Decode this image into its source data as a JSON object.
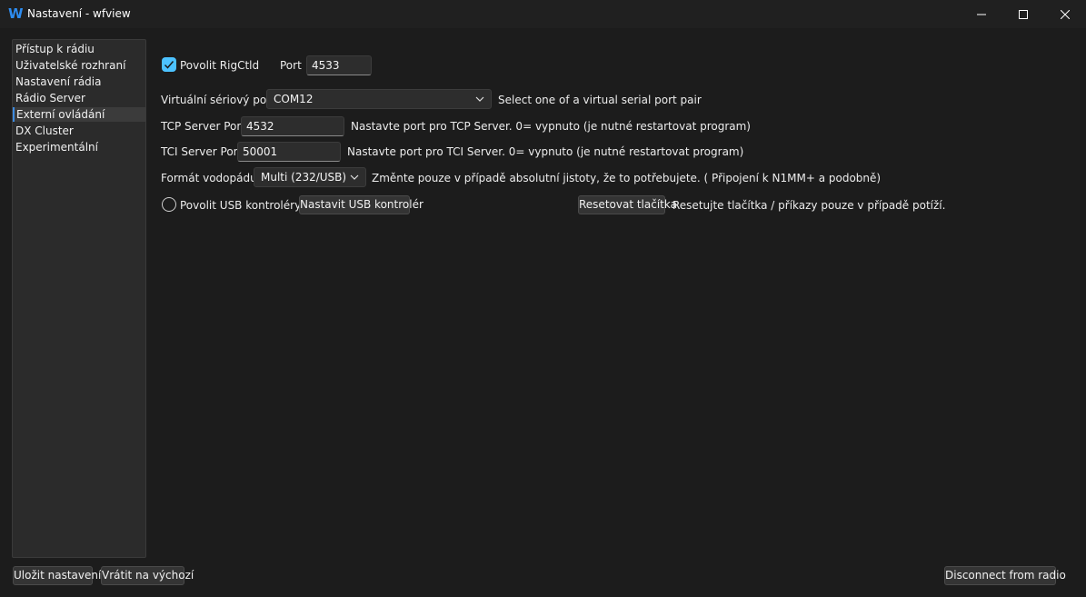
{
  "window": {
    "app_icon_glyph": "W",
    "title": "Nastavení - wfview",
    "icons": [
      "minimize-icon",
      "maximize-icon",
      "close-icon"
    ]
  },
  "sidebar": {
    "items": [
      {
        "label": "Přístup k rádiu",
        "selected": false
      },
      {
        "label": "Uživatelské rozhraní",
        "selected": false
      },
      {
        "label": "Nastavení rádia",
        "selected": false
      },
      {
        "label": "Rádio Server",
        "selected": false
      },
      {
        "label": "Externí ovládání",
        "selected": true
      },
      {
        "label": "DX Cluster",
        "selected": false
      },
      {
        "label": "Experimentální",
        "selected": false
      }
    ]
  },
  "rigctld": {
    "enable_label": "Povolit RigCtld",
    "enabled": true,
    "port_label": "Port",
    "port_value": "4533"
  },
  "virtual_serial": {
    "label": "Virtuální sériový port",
    "selected": "COM12",
    "hint": "Select one of a virtual serial port pair"
  },
  "tcp_server": {
    "label": "TCP Server Port",
    "value": "4532",
    "hint": "Nastavte port pro TCP Server. 0= vypnuto (je nutné restartovat program)"
  },
  "tci_server": {
    "label": "TCI Server Port",
    "value": "50001",
    "hint": "Nastavte port pro TCI Server. 0= vypnuto (je nutné restartovat program)"
  },
  "waterfall_format": {
    "label": "Formát vodopádu",
    "selected": "Multi (232/USB)",
    "hint": "Změnte pouze v případě absolutní jistoty, že to potřebujete. ( Připojení k N1MM+ a podobně)"
  },
  "usb": {
    "enable_label": "Povolit USB kontroléry",
    "enabled": false,
    "setup_button": "Nastavit USB kontrolér",
    "reset_button": "Resetovat tlačítka",
    "reset_hint": "Resetujte tlačítka / příkazy pouze v případě potíží."
  },
  "footer": {
    "save_button": "Uložit nastavení",
    "defaults_button": "Vrátit na výchozí",
    "disconnect_button": "Disconnect from radio"
  },
  "colors": {
    "accent": "#4cc2ff",
    "selection_marker": "#3d8be0",
    "app_icon": "#2d8cf0"
  }
}
